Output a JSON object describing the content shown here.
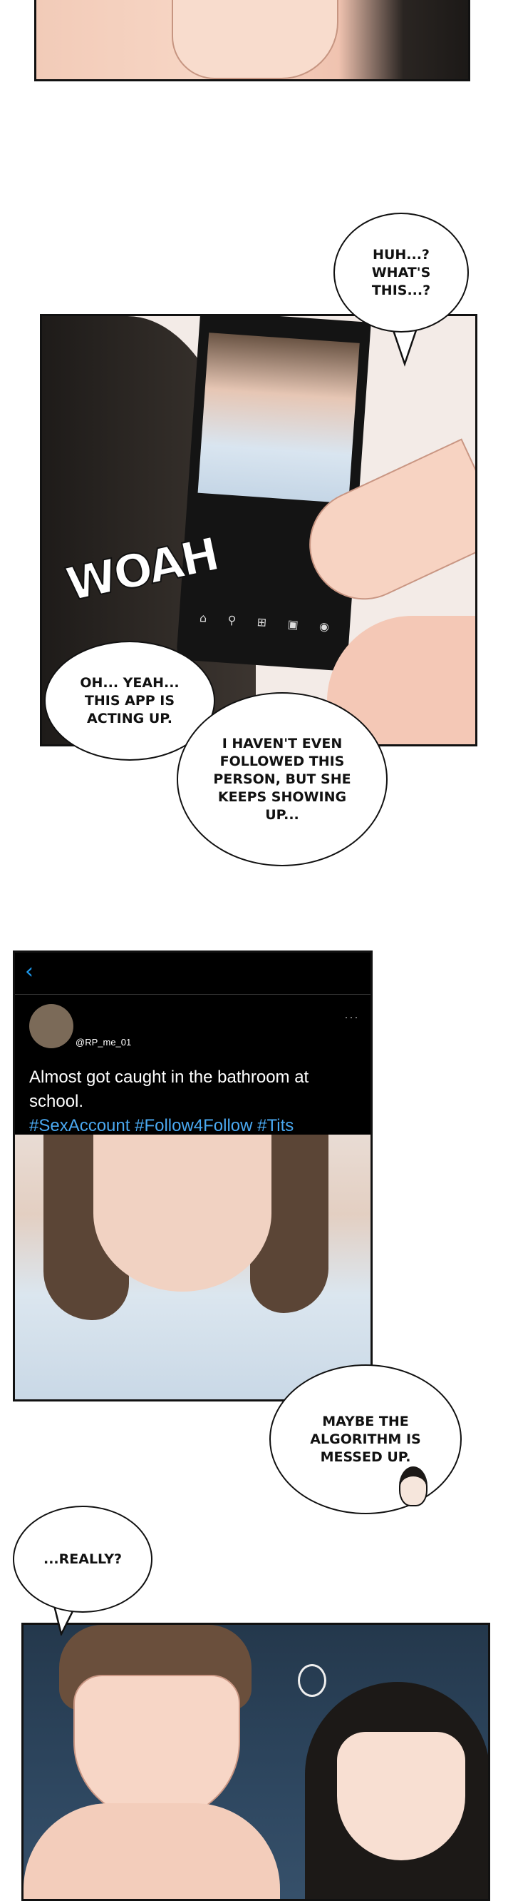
{
  "bubbles": {
    "huh": "HUH...?\nWHAT'S\nTHIS...?",
    "oh_yeah": "OH... YEAH...\nTHIS APP IS\nACTING UP.",
    "havent_followed": "I HAVEN'T EVEN\nFOLLOWED THIS\nPERSON, BUT SHE\nKEEPS SHOWING\nUP...",
    "algorithm": "MAYBE THE\nALGORITHM IS\nMESSED UP.",
    "really": "...REALLY?"
  },
  "sfx": {
    "woah": "WOAH"
  },
  "post": {
    "handle": "@RP_me_01",
    "more": "···",
    "caption": "Almost got caught in the bathroom at school.",
    "tags": "#SexAccount #Follow4Follow #Tits"
  },
  "colors": {
    "link": "#1d9bf0",
    "tag": "#4aa8f0",
    "skin": "#f3c7b4",
    "hair": "#3b3530"
  }
}
